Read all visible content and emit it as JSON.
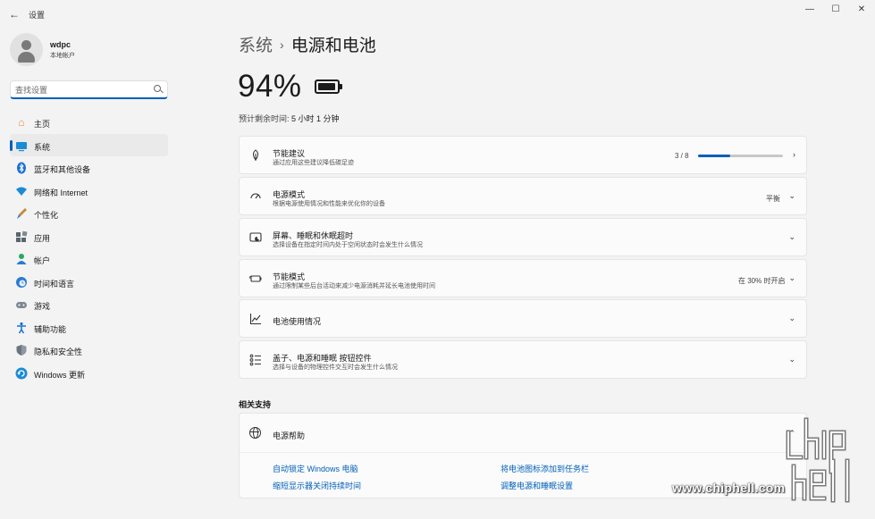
{
  "window": {
    "title": "设置",
    "controls": {
      "minimize": "—",
      "maximize": "☐",
      "close": "✕"
    }
  },
  "profile": {
    "name": "wdpc",
    "account_type": "本地帐户"
  },
  "search": {
    "placeholder": "查找设置"
  },
  "sidebar": {
    "items": [
      {
        "label": "主页",
        "icon": "home-icon",
        "active": false
      },
      {
        "label": "系统",
        "icon": "system-icon",
        "active": true
      },
      {
        "label": "蓝牙和其他设备",
        "icon": "bluetooth-icon",
        "active": false
      },
      {
        "label": "网络和 Internet",
        "icon": "wifi-icon",
        "active": false
      },
      {
        "label": "个性化",
        "icon": "brush-icon",
        "active": false
      },
      {
        "label": "应用",
        "icon": "apps-icon",
        "active": false
      },
      {
        "label": "帐户",
        "icon": "account-icon",
        "active": false
      },
      {
        "label": "时间和语言",
        "icon": "time-language-icon",
        "active": false
      },
      {
        "label": "游戏",
        "icon": "gamepad-icon",
        "active": false
      },
      {
        "label": "辅助功能",
        "icon": "accessibility-icon",
        "active": false
      },
      {
        "label": "隐私和安全性",
        "icon": "shield-icon",
        "active": false
      },
      {
        "label": "Windows 更新",
        "icon": "update-icon",
        "active": false
      }
    ]
  },
  "header": {
    "parent": "系统",
    "separator": "›",
    "title": "电源和电池"
  },
  "battery": {
    "percent": "94%",
    "level": 0.94,
    "remaining_label": "预计剩余时间:",
    "remaining_value": "5 小时 1 分钟"
  },
  "cards": [
    {
      "title": "节能建议",
      "desc": "通过应用这些建议降低碳足迹",
      "value": "3 / 8",
      "progress": 0.375,
      "icon": "leaf-icon",
      "chevron": "›"
    },
    {
      "title": "电源模式",
      "desc": "根据电源使用情况和性能来优化你的设备",
      "value": "平衡",
      "icon": "power-mode-icon",
      "chevron": "⌄"
    },
    {
      "title": "屏幕、睡眠和休眠超时",
      "desc": "选择设备在指定时间内处于空闲状态时会发生什么情况",
      "value": "",
      "icon": "screen-sleep-icon",
      "chevron": "⌄"
    },
    {
      "title": "节能模式",
      "desc": "通过限制某些后台活动来减少电源消耗并延长电池使用时间",
      "value": "在 30% 时开启",
      "icon": "battery-saver-icon",
      "chevron": "⌄"
    },
    {
      "title": "电池使用情况",
      "desc": "",
      "value": "",
      "icon": "chart-icon",
      "chevron": "⌄"
    },
    {
      "title": "盖子、电源和睡眠 按钮控件",
      "desc": "选择与设备的物理控件交互时会发生什么情况",
      "value": "",
      "icon": "list-icon",
      "chevron": "⌄"
    }
  ],
  "related": {
    "section_title": "相关支持",
    "help_title": "电源帮助",
    "help_chevron": "⌃",
    "links": [
      "自动锁定 Windows 电脑",
      "将电池图标添加到任务栏",
      "缩短显示器关闭持续时间",
      "调整电源和睡眠设置"
    ]
  },
  "watermark": {
    "logo_text": "chiphell",
    "site": "www.chiphell.com"
  }
}
